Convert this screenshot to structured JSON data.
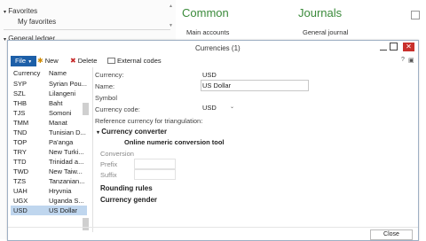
{
  "left_nav": {
    "favorites_label": "Favorites",
    "my_favorites_label": "My favorites",
    "general_ledger_label": "General ledger"
  },
  "workspace": {
    "common_title": "Common",
    "journals_title": "Journals",
    "main_accounts_link": "Main accounts",
    "general_journal_link": "General journal"
  },
  "dialog": {
    "title": "Currencies (1)",
    "close_glyph": "✕",
    "toolbar": {
      "file_label": "File",
      "new_label": "New",
      "delete_label": "Delete",
      "external_codes_label": "External codes"
    },
    "grid": {
      "columns": [
        "Currency",
        "Name"
      ],
      "rows": [
        {
          "code": "SYP",
          "name": "Syrian Pou..."
        },
        {
          "code": "SZL",
          "name": "Lilangeni"
        },
        {
          "code": "THB",
          "name": "Baht"
        },
        {
          "code": "TJS",
          "name": "Somoni"
        },
        {
          "code": "TMM",
          "name": "Manat"
        },
        {
          "code": "TND",
          "name": "Tunisian D..."
        },
        {
          "code": "TOP",
          "name": "Pa'anga"
        },
        {
          "code": "TRY",
          "name": "New Turki..."
        },
        {
          "code": "TTD",
          "name": "Trinidad a..."
        },
        {
          "code": "TWD",
          "name": "New Taiw..."
        },
        {
          "code": "TZS",
          "name": "Tanzanian..."
        },
        {
          "code": "UAH",
          "name": "Hryvnia"
        },
        {
          "code": "UGX",
          "name": "Uganda S..."
        },
        {
          "code": "USD",
          "name": "US Dollar"
        }
      ],
      "selected_code": "USD"
    },
    "form": {
      "currency_label": "Currency:",
      "currency_value": "USD",
      "name_label": "Name:",
      "name_value": "US Dollar",
      "symbol_label": "Symbol",
      "currency_code_label": "Currency code:",
      "currency_code_value": "USD",
      "triangulation_label": "Reference currency for triangulation:",
      "converter_section": "Currency converter",
      "online_tool_heading": "Online numeric conversion tool",
      "conversion_label": "Conversion",
      "prefix_label": "Prefix",
      "suffix_label": "Suffix",
      "rounding_section": "Rounding rules",
      "gender_section": "Currency gender"
    },
    "footer": {
      "close_label": "Close"
    }
  }
}
